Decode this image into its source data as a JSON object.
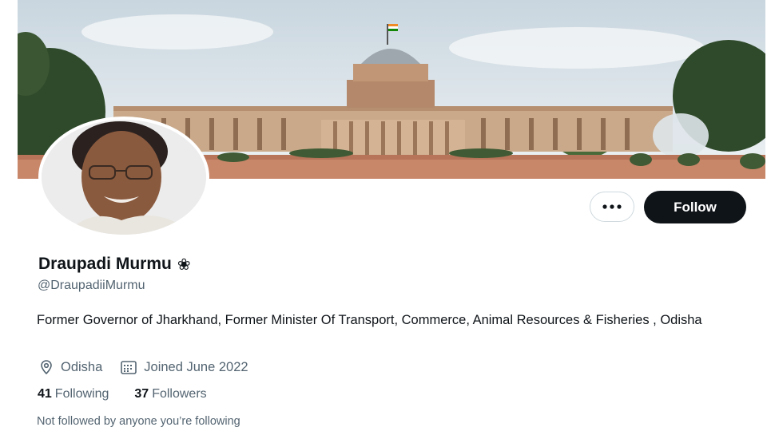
{
  "profile": {
    "display_name": "Draupadi Murmu",
    "name_emoji": "❀",
    "handle": "@DraupadiiMurmu",
    "bio": "Former Governor of Jharkhand, Former Minister Of Transport, Commerce, Animal Resources & Fisheries , Odisha",
    "location": "Odisha",
    "joined": "Joined June 2022",
    "following_count": "41",
    "following_label": "Following",
    "followers_count": "37",
    "followers_label": "Followers",
    "not_followed_text": "Not followed by anyone you’re following"
  },
  "actions": {
    "more_label": "•••",
    "follow_label": "Follow"
  },
  "icons": {
    "location": "location-pin-icon",
    "joined": "calendar-icon",
    "more": "more-options-icon"
  },
  "colors": {
    "text_primary": "#0f1419",
    "text_secondary": "#536471",
    "follow_button": "#0f1419",
    "border": "#cfd9de"
  }
}
